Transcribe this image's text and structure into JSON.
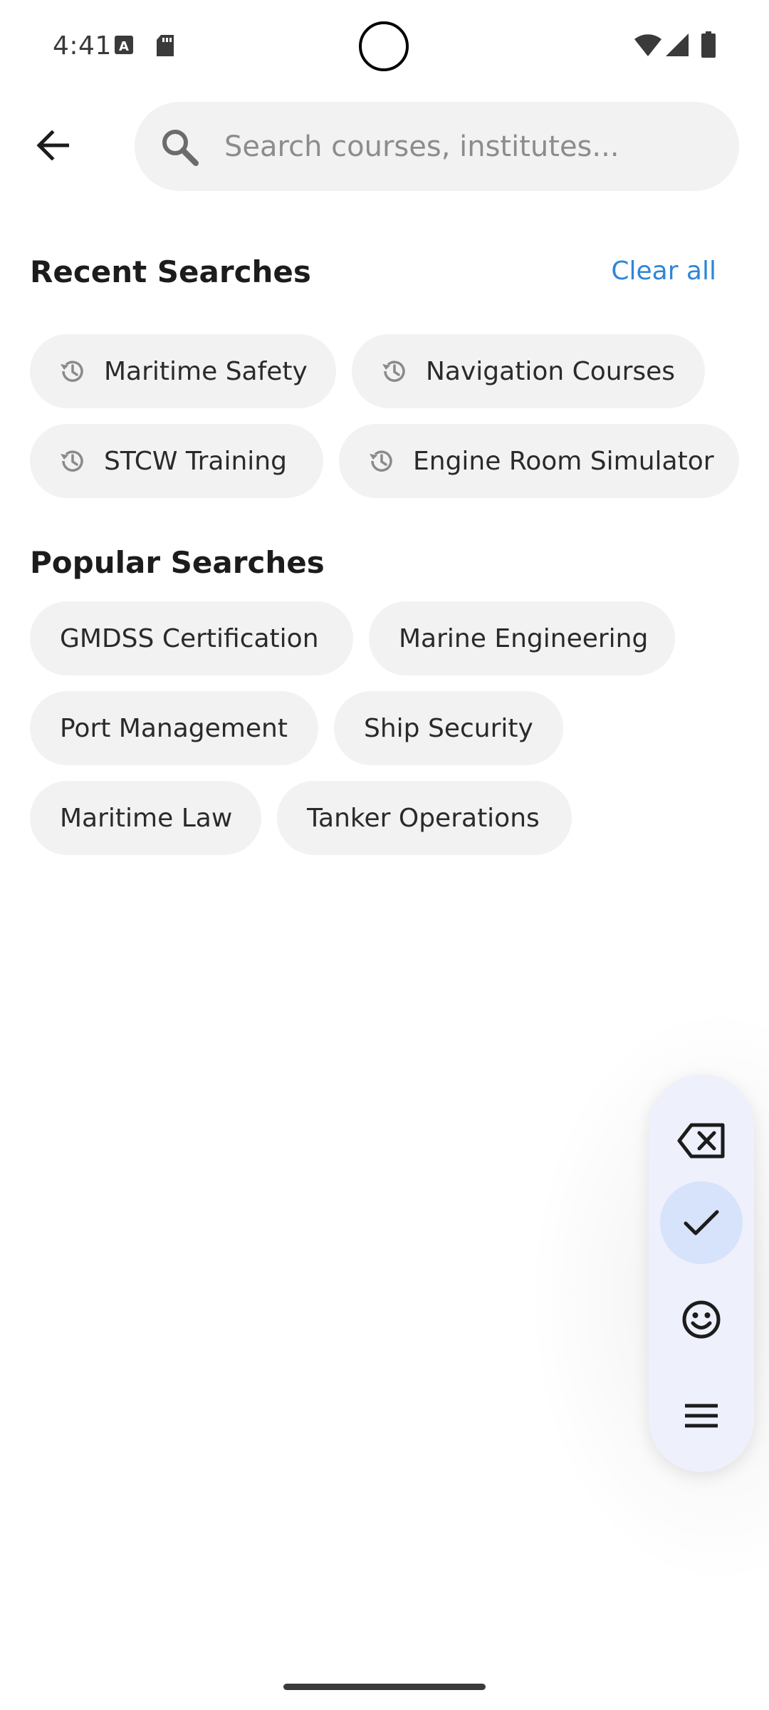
{
  "status_bar": {
    "time": "4:41",
    "icons": [
      "a-notification-icon",
      "sd-card-icon",
      "wifi-icon",
      "cellular-signal-icon",
      "battery-icon"
    ]
  },
  "top_bar": {
    "back_icon": "arrow-back-icon",
    "search": {
      "icon": "search-icon",
      "placeholder": "Search courses, institutes...",
      "value": ""
    }
  },
  "recent_searches": {
    "title": "Recent Searches",
    "clear_label": "Clear all",
    "items": [
      {
        "label": "Maritime Safety",
        "icon": "history-icon"
      },
      {
        "label": "Navigation Courses",
        "icon": "history-icon"
      },
      {
        "label": "STCW Training",
        "icon": "history-icon"
      },
      {
        "label": "Engine Room Simulator",
        "icon": "history-icon"
      }
    ]
  },
  "popular_searches": {
    "title": "Popular Searches",
    "items": [
      {
        "label": "GMDSS Certification"
      },
      {
        "label": "Marine Engineering"
      },
      {
        "label": "Port Management"
      },
      {
        "label": "Ship Security"
      },
      {
        "label": "Maritime Law"
      },
      {
        "label": "Tanker Operations"
      }
    ]
  },
  "keyboard_toolbar": {
    "buttons": [
      {
        "icon": "backspace-icon",
        "active": false
      },
      {
        "icon": "check-icon",
        "active": true
      },
      {
        "icon": "emoji-icon",
        "active": false
      },
      {
        "icon": "menu-icon",
        "active": false
      }
    ]
  },
  "colors": {
    "accent": "#2d86d8",
    "chip_background": "#f2f2f2",
    "toolbar_background": "#eef0fb",
    "toolbar_active": "#d7e2fb"
  }
}
